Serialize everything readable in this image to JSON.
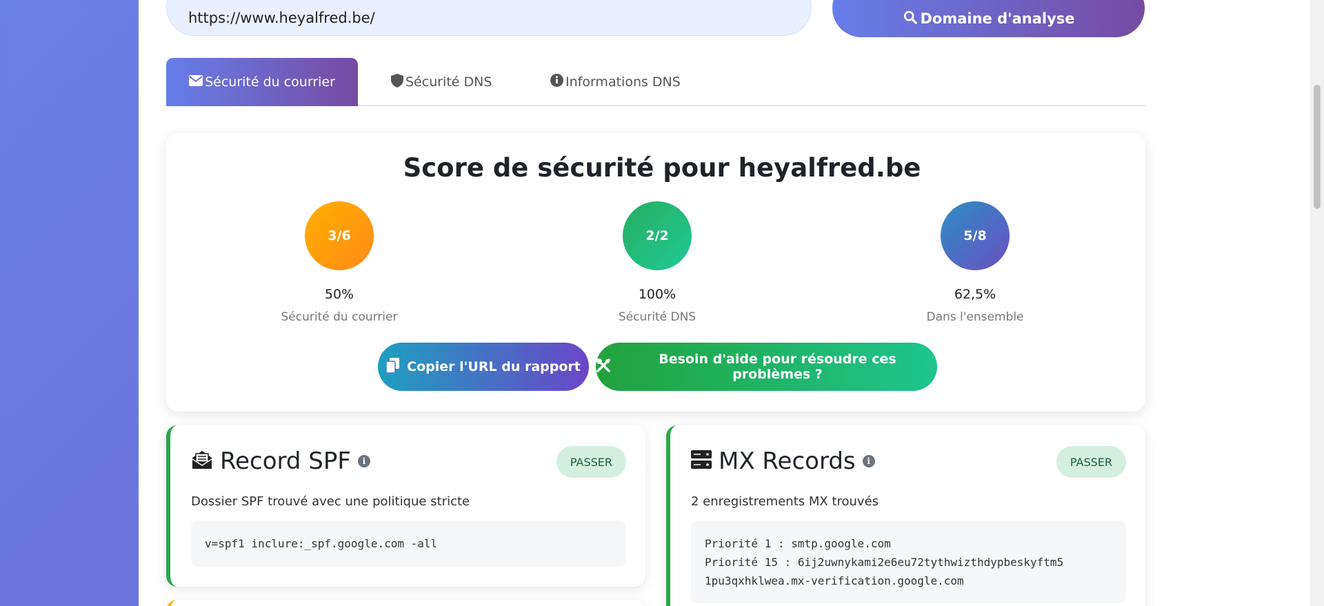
{
  "search": {
    "url_value": "https://www.heyalfred.be/",
    "analyze_label": "Domaine d'analyse"
  },
  "tabs": [
    {
      "label": "Sécurité du courrier",
      "icon": "envelope-icon",
      "active": true
    },
    {
      "label": "Sécurité DNS",
      "icon": "shield-icon",
      "active": false
    },
    {
      "label": "Informations DNS",
      "icon": "info-icon",
      "active": false
    }
  ],
  "score": {
    "title": "Score de sécurité pour heyalfred.be",
    "items": [
      {
        "value": "3/6",
        "percent": "50%",
        "label": "Sécurité du courrier",
        "color": "#ff9f0f"
      },
      {
        "value": "2/2",
        "percent": "100%",
        "label": "Sécurité DNS",
        "color": "#22b36a"
      },
      {
        "value": "5/8",
        "percent": "62,5%",
        "label": "Dans l'ensemble",
        "color": "#4a6fc4"
      }
    ],
    "copy_label": "Copier l'URL du rapport",
    "help_label": "Besoin d'aide pour résoudre ces problèmes ?"
  },
  "cards": {
    "spf": {
      "title": "Record SPF",
      "badge": "PASSER",
      "description": "Dossier SPF trouvé avec une politique stricte",
      "code": "v=spf1 inclure:_spf.google.com -all"
    },
    "mx": {
      "title": "MX Records",
      "badge": "PASSER",
      "description": "2 enregistrements MX trouvés",
      "lines": [
        "Priorité 1 : smtp.google.com",
        "Priorité 15 : 6ij2uwnykami2e6eu72tythwizthdypbeskyftm5",
        "1pu3qxhklwea.mx-verification.google.com"
      ]
    }
  },
  "colors": {
    "accent_start": "#667eea",
    "accent_end": "#764ba2",
    "pass_border": "#2aa84a",
    "pass_badge_bg": "#d4efe0"
  }
}
